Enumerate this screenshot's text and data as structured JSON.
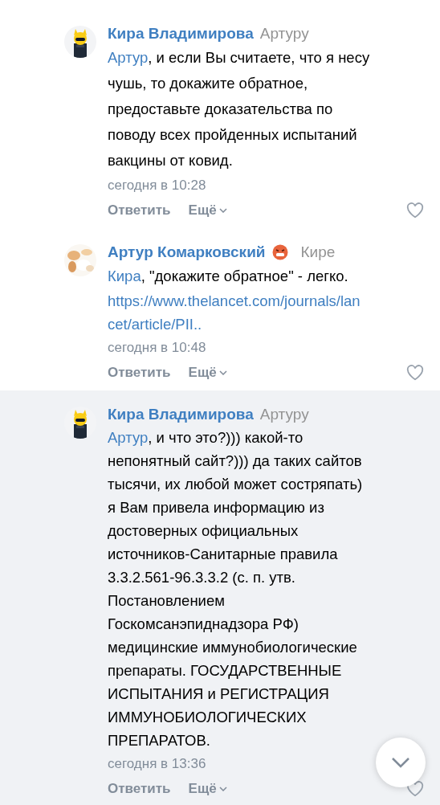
{
  "comments": [
    {
      "author": "Кира Владимирова",
      "angry_badge": false,
      "reply_to": "Артуру",
      "avatar": {
        "kind": "picture"
      },
      "highlighted": false,
      "liked": false,
      "mention": "Артур",
      "lines": [
        ", и если Вы считаете, что я несу",
        "чушь, то докажите обратное,",
        "предоставьте доказательства по",
        "поводу всех пройденных испытаний",
        "вакцины от ковид."
      ],
      "time": "сегодня в 10:28",
      "reply": "Ответить",
      "more": "Ещё"
    },
    {
      "author": "Артур Комарковский",
      "angry_badge": true,
      "reply_to": "Кире",
      "avatar": {
        "kind": "picture"
      },
      "highlighted": false,
      "liked": false,
      "mention": "Кира",
      "lines": [
        ", \"докажите обратное\" - легко."
      ],
      "link_lines": [
        "https://www.thelancet.com/journals/lan",
        "cet/article/PII.."
      ],
      "time": "сегодня в 10:48",
      "reply": "Ответить",
      "more": "Ещё"
    },
    {
      "author": "Кира Владимирова",
      "angry_badge": false,
      "reply_to": "Артуру",
      "avatar": {
        "kind": "picture"
      },
      "highlighted": true,
      "liked": false,
      "mention": "Артур",
      "lines": [
        ", и что это?))) какой-то",
        "непонятный сайт?))) да таких сайтов",
        "тысячи, их любой может состряпать)",
        "я Вам привела информацию из",
        "достоверных официальных",
        "источников-Санитарные правила",
        "3.3.2.561-96.3.3.2 (с. п. утв.",
        "Постановлением",
        "Госкомсанэпиднадзора РФ)",
        "медицинские иммунобиологические",
        "препараты. ГОСУДАРСТВЕННЫЕ",
        "ИСПЫТАНИЯ и РЕГИСТРАЦИЯ",
        "ИММУНОБИОЛОГИЧЕСКИХ",
        "ПРЕПАРАТОВ."
      ],
      "time": "сегодня в 13:36",
      "reply": "Ответить",
      "more": "Ещё"
    }
  ]
}
